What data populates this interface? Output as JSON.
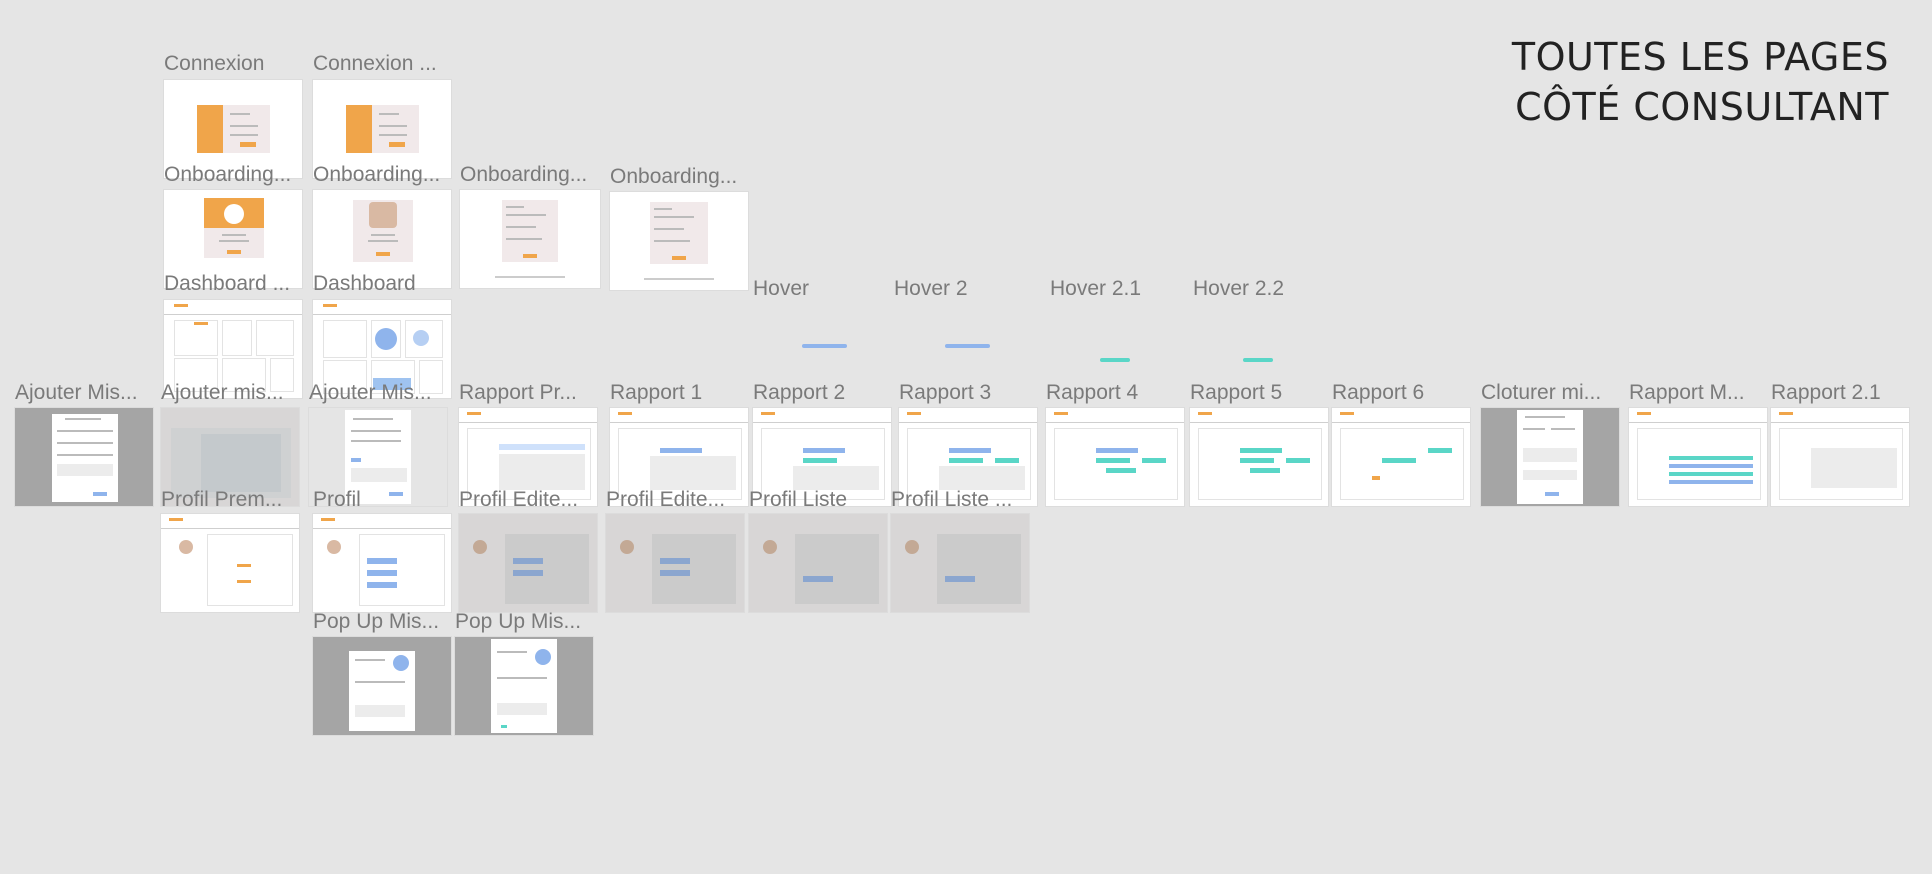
{
  "page": {
    "title_line1": "TOUTES LES PAGES",
    "title_line2": "CÔTÉ CONSULTANT"
  },
  "artboards": [
    {
      "key": "connexion",
      "label": "Connexion"
    },
    {
      "key": "connexion2",
      "label": "Connexion ..."
    },
    {
      "key": "onb1",
      "label": "Onboarding..."
    },
    {
      "key": "onb2",
      "label": "Onboarding..."
    },
    {
      "key": "onb3",
      "label": "Onboarding..."
    },
    {
      "key": "onb4",
      "label": "Onboarding..."
    },
    {
      "key": "dash1",
      "label": "Dashboard ..."
    },
    {
      "key": "dash2",
      "label": "Dashboard"
    },
    {
      "key": "hover",
      "label": "Hover"
    },
    {
      "key": "hover2",
      "label": "Hover 2"
    },
    {
      "key": "hover21",
      "label": "Hover 2.1"
    },
    {
      "key": "hover22",
      "label": "Hover 2.2"
    },
    {
      "key": "ajout1",
      "label": "Ajouter Mis..."
    },
    {
      "key": "ajout2",
      "label": "Ajouter mis..."
    },
    {
      "key": "ajout3",
      "label": "Ajouter Mis..."
    },
    {
      "key": "rapportpr",
      "label": "Rapport Pr..."
    },
    {
      "key": "rapport1",
      "label": "Rapport 1"
    },
    {
      "key": "rapport2",
      "label": "Rapport 2"
    },
    {
      "key": "rapport3",
      "label": "Rapport 3"
    },
    {
      "key": "rapport4",
      "label": "Rapport 4"
    },
    {
      "key": "rapport5",
      "label": "Rapport 5"
    },
    {
      "key": "rapport6",
      "label": "Rapport 6"
    },
    {
      "key": "cloturer",
      "label": "Cloturer mi..."
    },
    {
      "key": "rapportm",
      "label": "Rapport M..."
    },
    {
      "key": "rapport21",
      "label": "Rapport 2.1"
    },
    {
      "key": "profilprem",
      "label": "Profil Prem..."
    },
    {
      "key": "profil",
      "label": "Profil"
    },
    {
      "key": "profiledit1",
      "label": "Profil Edite..."
    },
    {
      "key": "profiledit2",
      "label": "Profil Edite..."
    },
    {
      "key": "profilliste1",
      "label": "Profil Liste"
    },
    {
      "key": "profilliste2",
      "label": "Profil Liste ..."
    },
    {
      "key": "popup1",
      "label": "Pop Up Mis..."
    },
    {
      "key": "popup2",
      "label": "Pop Up Mis..."
    }
  ],
  "colors": {
    "canvas": "#e5e5e5",
    "accent_orange": "#f0a54a",
    "accent_blue": "#8fb4ec",
    "accent_teal": "#5ad6c7"
  }
}
